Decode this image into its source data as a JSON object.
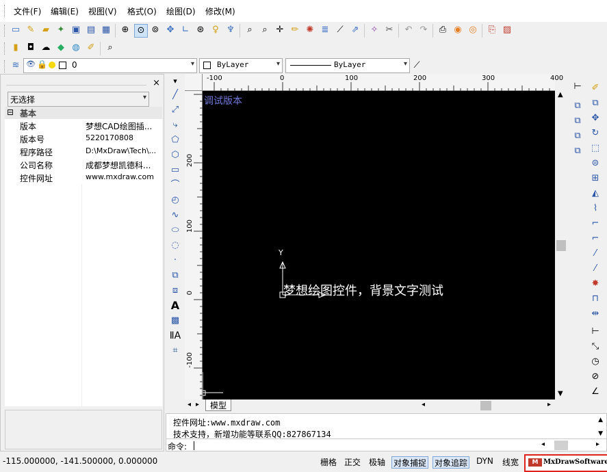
{
  "menu": [
    "文件(F)",
    "编辑(E)",
    "视图(V)",
    "格式(O)",
    "绘图(D)",
    "修改(M)"
  ],
  "layer": {
    "name": "0",
    "color_label": "ByLayer",
    "linetype_label": "ByLayer"
  },
  "properties": {
    "selection": "无选择",
    "group": "基本",
    "rows": [
      {
        "key": "版本",
        "value": "梦想CAD绘图插..."
      },
      {
        "key": "版本号",
        "value": "5220170808"
      },
      {
        "key": "程序路径",
        "value": "D:\\MxDraw\\Tech\\..."
      },
      {
        "key": "公司名称",
        "value": "成都梦想凯德科..."
      },
      {
        "key": "控件网址",
        "value": "www.mxdraw.com"
      }
    ],
    "close": "×",
    "collapse": "⊟"
  },
  "ruler": {
    "h_ticks": [
      "-100",
      "0",
      "100",
      "200",
      "300",
      "400"
    ],
    "v_ticks": [
      "200",
      "100",
      "0",
      "-100"
    ]
  },
  "drawing": {
    "watermark": "调试版本",
    "text": "梦想绘图控件，背景文字测试",
    "y_axis_label": "Y"
  },
  "tabs": {
    "model": "模型"
  },
  "command": {
    "lines": [
      "控件网址:www.mxdraw.com",
      "技术支持，新增功能等联系QQ:827867134"
    ],
    "prompt": "命令:"
  },
  "status": {
    "coords": "-115.000000, -141.500000, 0.000000",
    "buttons": [
      {
        "label": "栅格",
        "on": false
      },
      {
        "label": "正交",
        "on": false
      },
      {
        "label": "极轴",
        "on": false
      },
      {
        "label": "对象捕捉",
        "on": true
      },
      {
        "label": "对象追踪",
        "on": true
      },
      {
        "label": "DYN",
        "on": false
      },
      {
        "label": "线宽",
        "on": false
      }
    ],
    "brand": "MxDrawSoftware"
  },
  "colors": {
    "canvas": "#000000",
    "watermark": "#6f78d8",
    "brand_border": "#e0201a"
  }
}
